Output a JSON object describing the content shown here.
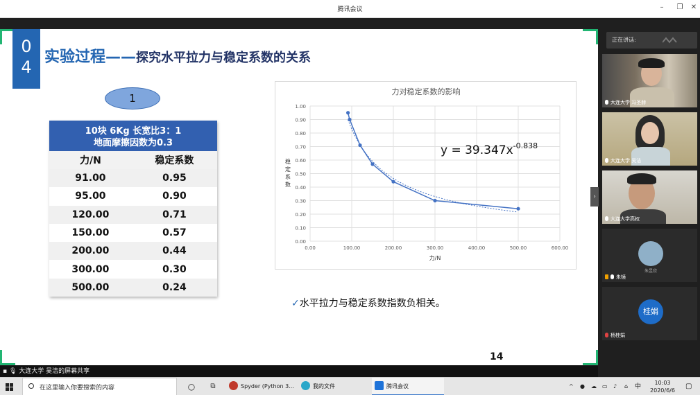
{
  "window": {
    "title": "腾讯会议"
  },
  "slide": {
    "section_number": "0\n4",
    "title_main": "实验过程",
    "title_dash": "——",
    "title_sub": "探究水平拉力与稳定系数的关系",
    "oval_label": "1",
    "table": {
      "header_line1": "10块 6Kg 长宽比3：1",
      "header_line2": "地面摩擦因数为0.3",
      "columns": [
        "力/N",
        "稳定系数"
      ],
      "rows": [
        [
          "91.00",
          "0.95"
        ],
        [
          "95.00",
          "0.90"
        ],
        [
          "120.00",
          "0.71"
        ],
        [
          "150.00",
          "0.57"
        ],
        [
          "200.00",
          "0.44"
        ],
        [
          "300.00",
          "0.30"
        ],
        [
          "500.00",
          "0.24"
        ]
      ]
    },
    "conclusion_check": "✓",
    "conclusion": "水平拉力与稳定系数指数负相关。",
    "page_number": "14"
  },
  "chart_data": {
    "type": "scatter",
    "title": "力对稳定系数的影响",
    "xlabel": "力/N",
    "ylabel": "稳定系数",
    "xlim": [
      0,
      600
    ],
    "ylim": [
      0,
      1
    ],
    "x_ticks": [
      "0.00",
      "100.00",
      "200.00",
      "300.00",
      "400.00",
      "500.00",
      "600.00"
    ],
    "y_ticks": [
      "0.00",
      "0.10",
      "0.20",
      "0.30",
      "0.40",
      "0.50",
      "0.60",
      "0.70",
      "0.80",
      "0.90",
      "1.00"
    ],
    "grid": true,
    "series": [
      {
        "x": [
          91,
          95,
          120,
          150,
          200,
          300,
          500
        ],
        "y": [
          0.95,
          0.9,
          0.71,
          0.57,
          0.44,
          0.3,
          0.24
        ]
      }
    ],
    "trendline": {
      "type": "power",
      "a": 39.347,
      "b": -0.838,
      "equation_base": "y = 39.347x",
      "equation_exp": "-0.838"
    },
    "colors": {
      "series": "#4472c4",
      "grid": "#e0e0e0"
    }
  },
  "panel": {
    "speaking_label": "正在讲话:",
    "participants": [
      {
        "name": "大连大学 冯圣赫",
        "mic": "on"
      },
      {
        "name": "大连大学 吴洁",
        "mic": "on"
      },
      {
        "name": "大连大学高权",
        "mic": "on"
      },
      {
        "name": "朱镜",
        "avatar_text": "朱昱欣",
        "mic": "on"
      },
      {
        "name": "杨桂娟",
        "avatar_text": "桂娟",
        "mic": "off"
      }
    ]
  },
  "share_bar": "大连大学 吴洁的屏幕共享",
  "taskbar": {
    "search_placeholder": "在这里输入你要搜索的内容",
    "apps": [
      "Spyder (Python 3...",
      "我的文件",
      "腾讯会议"
    ],
    "tray_ime": "中",
    "time": "10:03",
    "date": "2020/6/6"
  }
}
